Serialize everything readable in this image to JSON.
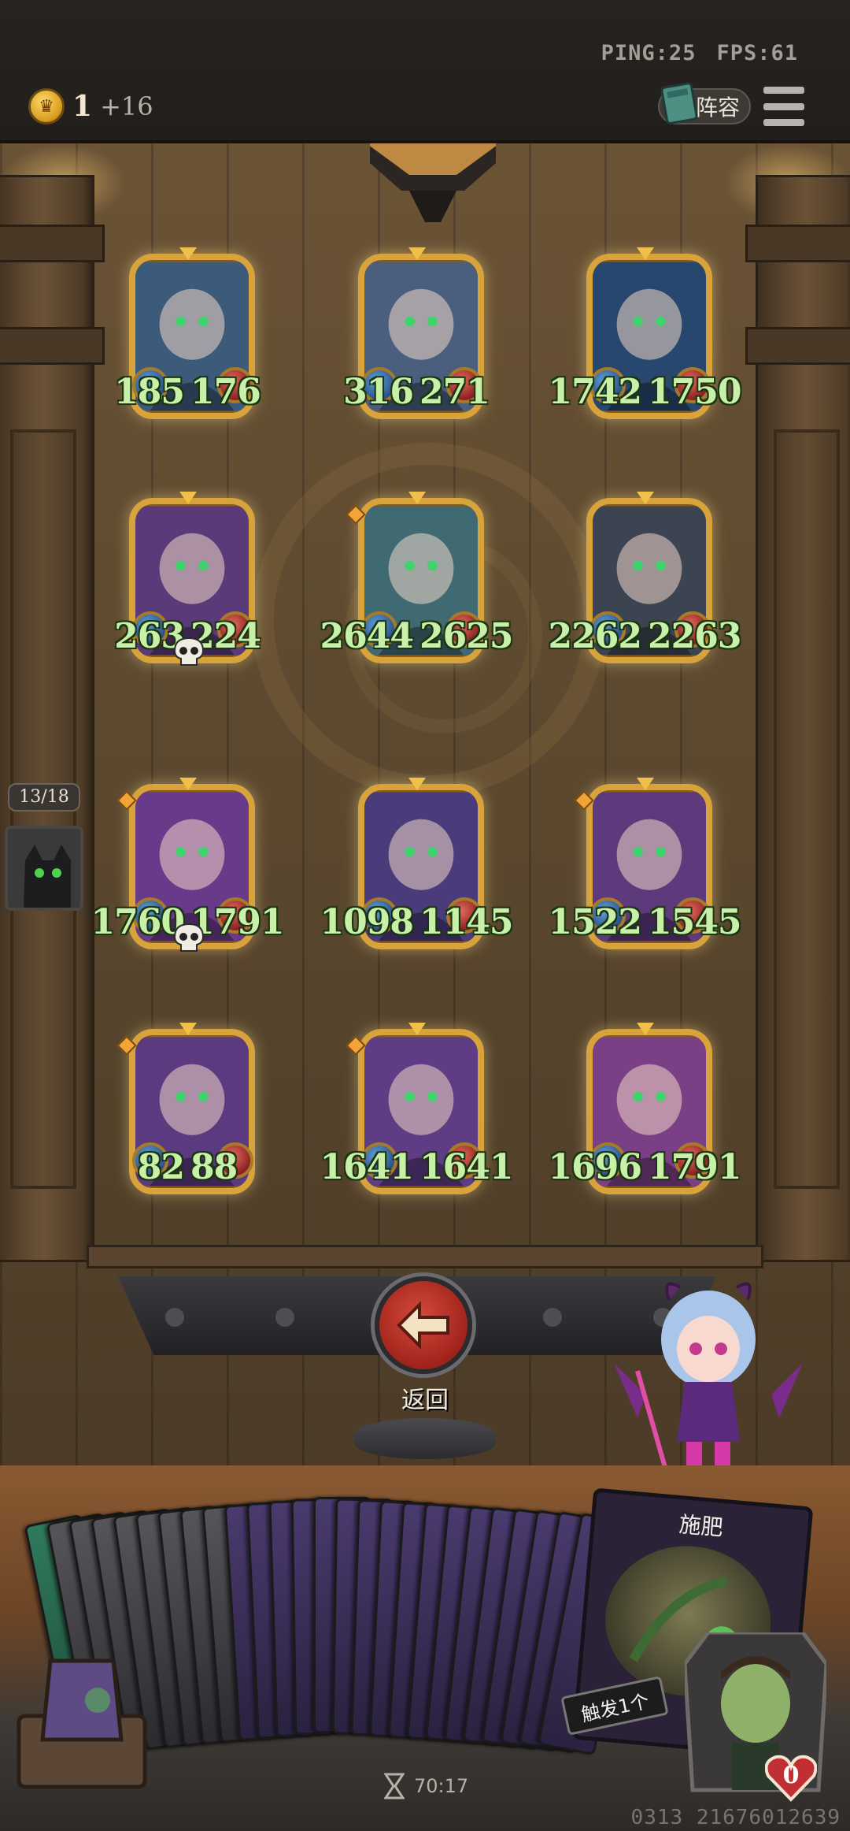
{
  "status": {
    "ping": "PING:25",
    "fps": "FPS:61"
  },
  "currency": {
    "amount": "1",
    "income": "+16"
  },
  "lineup_button": {
    "label": "阵容"
  },
  "unit_counter": "13/18",
  "cards": [
    {
      "atk": "185",
      "hp": "176",
      "portrait": "elf-sorceress",
      "color": "#3c5a7a",
      "skull": false,
      "diamond": false
    },
    {
      "atk": "316",
      "hp": "271",
      "portrait": "bearded-king",
      "color": "#4a5f7d",
      "skull": false,
      "diamond": false
    },
    {
      "atk": "1742",
      "hp": "1750",
      "portrait": "ice-crystal-beast",
      "color": "#28476e",
      "skull": false,
      "diamond": false
    },
    {
      "atk": "263",
      "hp": "224",
      "portrait": "blue-haired-witch",
      "color": "#5a3a78",
      "skull": true,
      "diamond": false
    },
    {
      "atk": "2644",
      "hp": "2625",
      "portrait": "water-nymph",
      "color": "#3f6a72",
      "skull": false,
      "diamond": true
    },
    {
      "atk": "2262",
      "hp": "2263",
      "portrait": "mushroom-creature",
      "color": "#3c4452",
      "skull": false,
      "diamond": false
    },
    {
      "atk": "1760",
      "hp": "1791",
      "portrait": "pumpkin-witch-girl",
      "color": "#6a3a8a",
      "skull": true,
      "diamond": true
    },
    {
      "atk": "1098",
      "hp": "1145",
      "portrait": "goblin-jester",
      "color": "#4a3b7a",
      "skull": false,
      "diamond": false
    },
    {
      "atk": "1522",
      "hp": "1545",
      "portrait": "dark-mushroom",
      "color": "#5c3a7c",
      "skull": false,
      "diamond": true
    },
    {
      "atk": "82",
      "hp": "88",
      "portrait": "gray-wolf-bandit",
      "color": "#5b3a80",
      "skull": false,
      "diamond": true
    },
    {
      "atk": "1641",
      "hp": "1641",
      "portrait": "husky-dog",
      "color": "#5e3d84",
      "skull": false,
      "diamond": true
    },
    {
      "atk": "1696",
      "hp": "1791",
      "portrait": "pink-haired-lady",
      "color": "#7b3f86",
      "skull": false,
      "diamond": false
    }
  ],
  "back_button": {
    "label": "返回"
  },
  "hand": {
    "card_count": 26,
    "featured_card": {
      "name": "施肥",
      "trigger_text": "触发1个"
    }
  },
  "timer": "70:17",
  "player_health": "0",
  "build_id": "0313 21676012639",
  "colors": {
    "stat_text": "#c8f0a8",
    "frame_gold": "#d8a33b",
    "back_red": "#c0362b"
  }
}
